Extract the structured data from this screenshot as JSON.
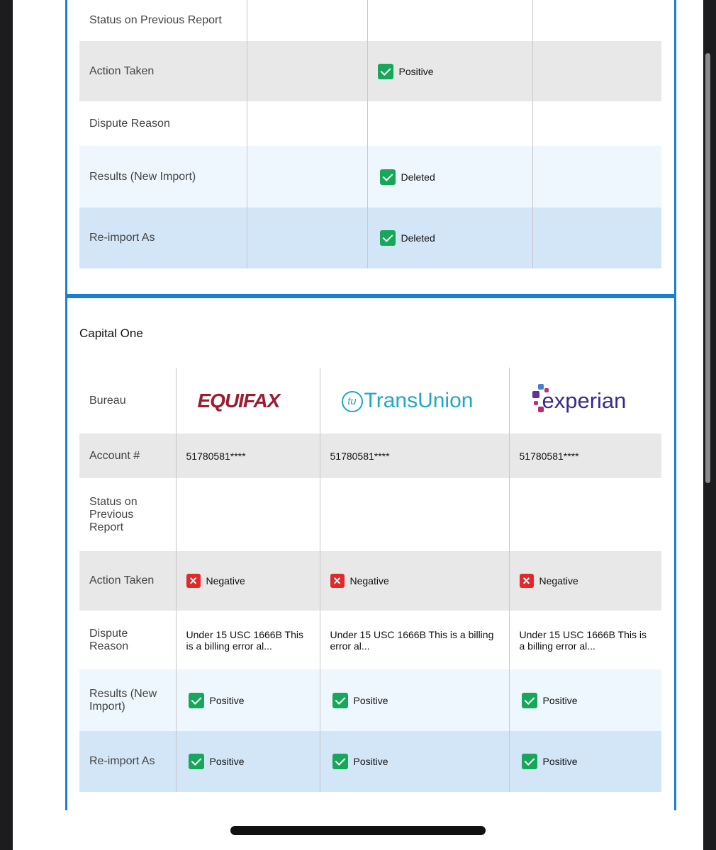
{
  "card1": {
    "rows": [
      {
        "label": "Status on Previous Report",
        "cells": [
          "",
          "",
          ""
        ]
      },
      {
        "label": "Action Taken",
        "cells": [
          "",
          "Positive",
          ""
        ],
        "icons": [
          "",
          "check-icon",
          ""
        ]
      },
      {
        "label": "Dispute Reason",
        "cells": [
          "",
          "",
          ""
        ]
      },
      {
        "label": "Results (New Import)",
        "cells": [
          "",
          "Deleted",
          ""
        ],
        "icons": [
          "",
          "check-icon",
          ""
        ]
      },
      {
        "label": "Re-import As",
        "cells": [
          "",
          "Deleted",
          ""
        ],
        "icons": [
          "",
          "check-icon",
          ""
        ]
      }
    ]
  },
  "card2": {
    "title": "Capital One",
    "bureau_label": "Bureau",
    "bureaus": [
      "EQUIFAX",
      "TransUnion",
      "experian"
    ],
    "account_label": "Account #",
    "accounts": [
      "51780581****",
      "51780581****",
      "51780581****"
    ],
    "status_label": "Status on Previous Report",
    "action_label": "Action Taken",
    "actions": [
      "Negative",
      "Negative",
      "Negative"
    ],
    "dispute_label": "Dispute Reason",
    "disputes": [
      "Under 15 USC 1666B This is a billing error al...",
      "Under 15 USC 1666B This is a billing error al...",
      "Under 15 USC 1666B This is a billing error al..."
    ],
    "results_label": "Results (New Import)",
    "results": [
      "Positive",
      "Positive",
      "Positive"
    ],
    "reimport_label": "Re-import As",
    "reimport": [
      "Positive",
      "Positive",
      "Positive"
    ]
  },
  "colors": {
    "accent": "#1a7fd4",
    "positive": "#17a75a",
    "negative": "#e02a2a"
  }
}
